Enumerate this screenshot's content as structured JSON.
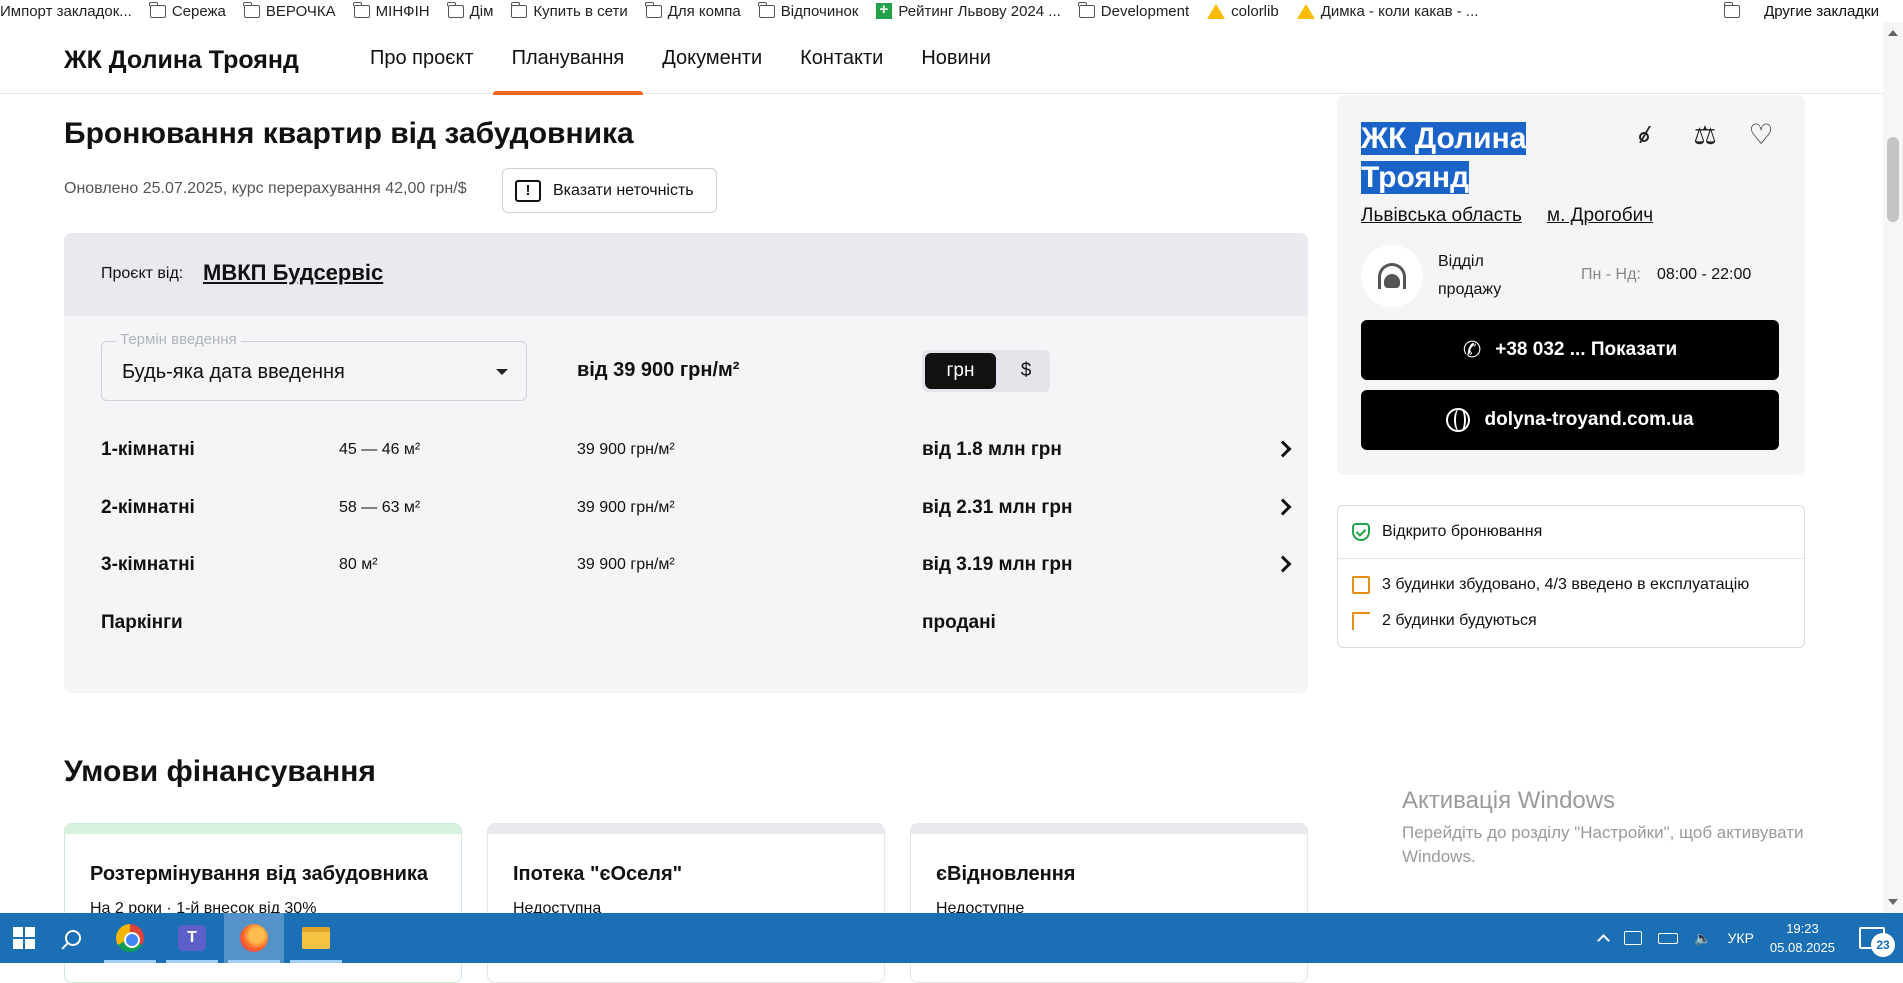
{
  "bookmarks": {
    "items": [
      {
        "label": "Импорт закладок...",
        "icon": "folder-icon"
      },
      {
        "label": "Сережа",
        "icon": "folder-icon"
      },
      {
        "label": "ВЕРОЧКА",
        "icon": "folder-icon"
      },
      {
        "label": "МІНФІН",
        "icon": "folder-icon"
      },
      {
        "label": "Дім",
        "icon": "folder-icon"
      },
      {
        "label": "Купить в сети",
        "icon": "folder-icon"
      },
      {
        "label": "Для компа",
        "icon": "folder-icon"
      },
      {
        "label": "Відпочинок",
        "icon": "folder-icon"
      },
      {
        "label": "Рейтинг Львову 2024 ...",
        "icon": "sheets-icon"
      },
      {
        "label": "Development",
        "icon": "folder-icon"
      },
      {
        "label": "colorlib",
        "icon": "drive-icon"
      },
      {
        "label": "Димка - коли какав - ...",
        "icon": "drive-icon"
      }
    ],
    "other": "Другие закладки"
  },
  "header": {
    "logo": "ЖК Долина Троянд",
    "nav": [
      "Про проєкт",
      "Планування",
      "Документи",
      "Контакти",
      "Новини"
    ],
    "active_index": 1,
    "accent_color": "#f26522"
  },
  "main": {
    "title": "Бронювання квартир від забудовника",
    "updated": "Оновлено 25.07.2025, курс перерахування 42,00 грн/$",
    "report_label": "Вказати неточність",
    "project_label": "Проєкт від:",
    "developer": "МВКП Будсервіс",
    "select": {
      "legend": "Термін введення",
      "value": "Будь-яка дата введення"
    },
    "price_from": "від 39 900 грн/м²",
    "currency": {
      "uah": "грн",
      "usd": "$",
      "selected": "грн"
    },
    "rows": [
      {
        "type": "1-кімнатні",
        "area": "45 — 46 м²",
        "price_m2": "39 900 грн/м²",
        "total": "від 1.8 млн грн"
      },
      {
        "type": "2-кімнатні",
        "area": "58 — 63 м²",
        "price_m2": "39 900 грн/м²",
        "total": "від 2.31 млн грн"
      },
      {
        "type": "3-кімнатні",
        "area": "80 м²",
        "price_m2": "39 900 грн/м²",
        "total": "від 3.19 млн грн"
      },
      {
        "type": "Паркінги",
        "area": "",
        "price_m2": "",
        "total": "продані"
      }
    ],
    "financing_title": "Умови фінансування",
    "financing": [
      {
        "title": "Розтермінування від забудовника",
        "sub": "На 2 роки · 1-й внесок від 30%"
      },
      {
        "title": "Іпотека \"єОселя\"",
        "sub": "Недоступна"
      },
      {
        "title": "єВідновлення",
        "sub": "Недоступне"
      }
    ]
  },
  "sidebar": {
    "title_line1": "ЖК Долина",
    "title_line2": "Троянд",
    "region": "Львівська область",
    "city": "м. Дрогобич",
    "dept": "Відділ продажу",
    "hours_label": "Пн - Нд:",
    "hours": "08:00 - 22:00",
    "phone": "+38 032 ... Показати",
    "website": "dolyna-troyand.com.ua",
    "status": [
      {
        "text": "Відкрито бронювання",
        "icon": "shield-check-icon"
      },
      {
        "text": "3 будинки збудовано, 4/3 введено в експлуатацію",
        "icon": "document-icon"
      },
      {
        "text": "2 будинки будуються",
        "icon": "crane-icon"
      }
    ]
  },
  "watermark": {
    "title": "Активація Windows",
    "sub": "Перейдіть до розділу \"Настройки\", щоб активувати Windows."
  },
  "taskbar": {
    "lang": "УКР",
    "time": "19:23",
    "date": "05.08.2025",
    "notifications": "23",
    "color": "#1a6fb5"
  }
}
